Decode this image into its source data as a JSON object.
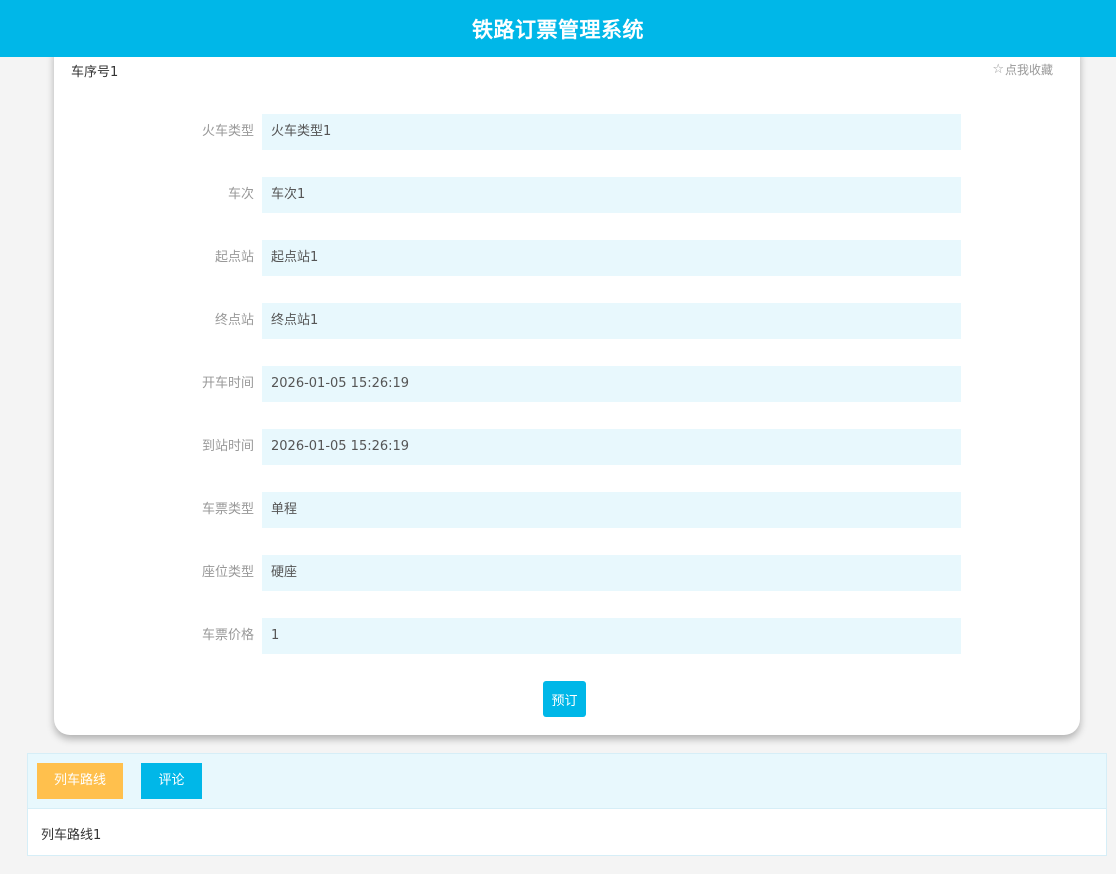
{
  "header": {
    "title": "铁路订票管理系统"
  },
  "detail": {
    "train_seq": "车序号1",
    "favorite_label": "点我收藏",
    "fields": [
      {
        "label": "火车类型",
        "value": "火车类型1"
      },
      {
        "label": "车次",
        "value": "车次1"
      },
      {
        "label": "起点站",
        "value": "起点站1"
      },
      {
        "label": "终点站",
        "value": "终点站1"
      },
      {
        "label": "开车时间",
        "value": "2026-01-05 15:26:19"
      },
      {
        "label": "到站时间",
        "value": "2026-01-05 15:26:19"
      },
      {
        "label": "车票类型",
        "value": "单程"
      },
      {
        "label": "座位类型",
        "value": "硬座"
      },
      {
        "label": "车票价格",
        "value": "1"
      }
    ],
    "book_label": "预订"
  },
  "tabs": {
    "items": [
      {
        "label": "列车路线",
        "color": "#ffc04d"
      },
      {
        "label": "评论",
        "color": "#00b7e8"
      }
    ],
    "content": "列车路线1"
  },
  "colors": {
    "brand": "#00b7e8",
    "accent": "#ffc04d",
    "field_bg": "#e8f8fd"
  },
  "icons": {
    "favorite": "star-outline-icon"
  }
}
